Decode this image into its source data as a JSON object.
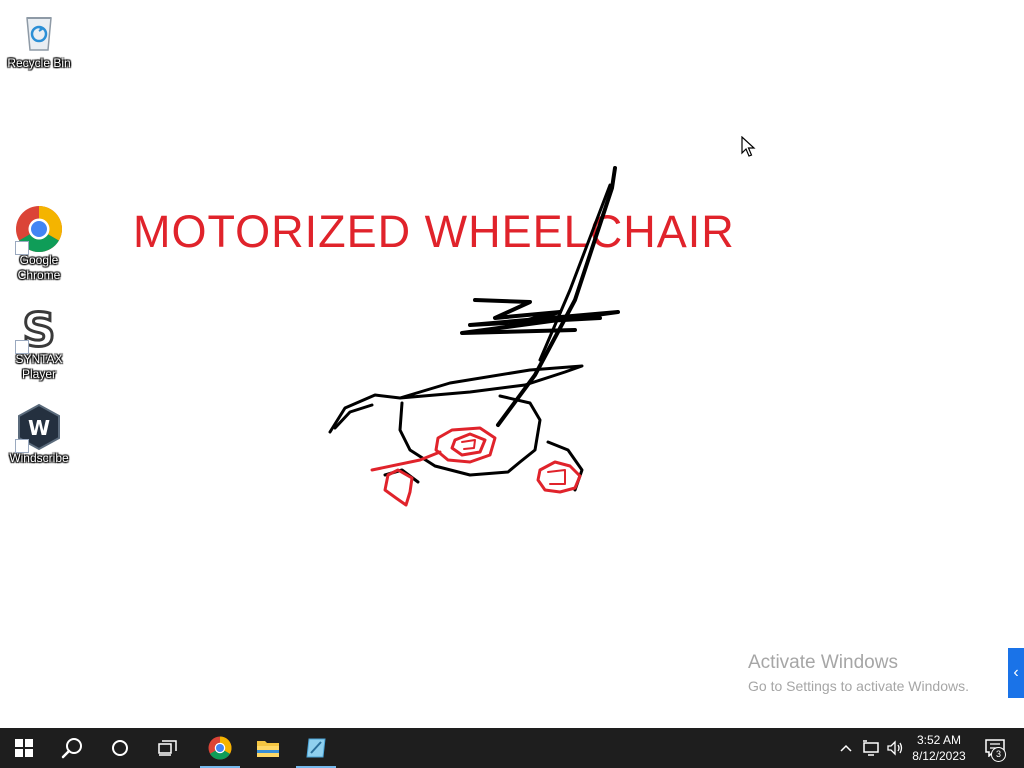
{
  "desktop": {
    "icons": [
      {
        "label": "Recycle Bin",
        "icon": "recycle-bin-icon"
      },
      {
        "label": "Google\nChrome",
        "icon": "chrome-icon"
      },
      {
        "label": "SYNTAX\nPlayer",
        "icon": "syntax-player-icon"
      },
      {
        "label": "Windscribe",
        "icon": "windscribe-icon"
      }
    ],
    "painting": {
      "title": "MOTORIZED WHEELCHAIR",
      "title_color": "#e0232b",
      "stroke_color": "#000000"
    },
    "activation": {
      "heading": "Activate Windows",
      "subtext": "Go to Settings to activate Windows."
    },
    "side_tab_glyph": "‹"
  },
  "taskbar": {
    "buttons": [
      {
        "name": "start",
        "icon": "windows-logo-icon"
      },
      {
        "name": "search",
        "icon": "search-icon"
      },
      {
        "name": "cortana",
        "icon": "cortana-circle-icon"
      },
      {
        "name": "task-view",
        "icon": "task-view-icon"
      },
      {
        "name": "chrome",
        "icon": "chrome-icon"
      },
      {
        "name": "file-explorer",
        "icon": "folder-icon"
      },
      {
        "name": "paint",
        "icon": "paint-icon"
      }
    ],
    "tray": {
      "chevron": "^",
      "time": "3:52 AM",
      "date": "8/12/2023",
      "notification_count": "3"
    },
    "accent": "#76b9ed"
  }
}
